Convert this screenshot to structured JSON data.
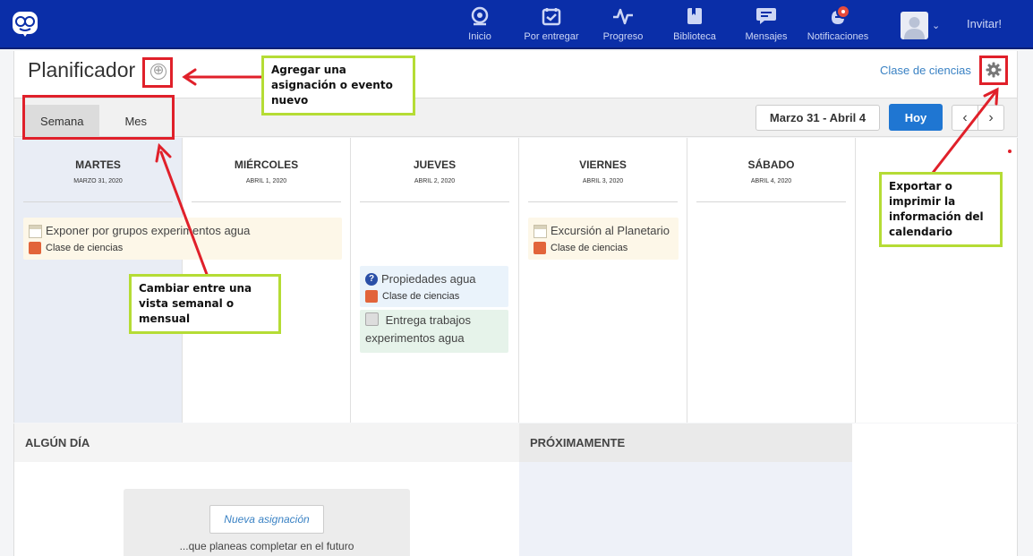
{
  "nav": {
    "items": [
      {
        "label": "Inicio",
        "icon": "home-icon"
      },
      {
        "label": "Por entregar",
        "icon": "assignments-icon"
      },
      {
        "label": "Progreso",
        "icon": "progress-icon"
      },
      {
        "label": "Biblioteca",
        "icon": "library-icon"
      },
      {
        "label": "Mensajes",
        "icon": "messages-icon"
      },
      {
        "label": "Notificaciones",
        "icon": "notifications-icon"
      }
    ],
    "invite": "Invitar!"
  },
  "planner": {
    "title": "Planificador",
    "add_symbol": "⊕",
    "class_link": "Clase de ciencias",
    "view_tabs": {
      "week": "Semana",
      "month": "Mes"
    },
    "date_range": "Marzo 31 - Abril 4",
    "today": "Hoy",
    "prev": "‹",
    "next": "›"
  },
  "days": [
    {
      "name": "MARTES",
      "date": "MARZO 31, 2020"
    },
    {
      "name": "MIÉRCOLES",
      "date": "ABRIL 1, 2020"
    },
    {
      "name": "JUEVES",
      "date": "ABRIL 2, 2020"
    },
    {
      "name": "VIERNES",
      "date": "ABRIL 3, 2020"
    },
    {
      "name": "SÁBADO",
      "date": "ABRIL 4, 2020"
    }
  ],
  "events": {
    "tuesday": {
      "title": "Exponer por grupos experimentos agua",
      "class": "Clase de ciencias"
    },
    "thursday_1": {
      "title": "Propiedades agua",
      "class": "Clase de ciencias"
    },
    "thursday_2": {
      "title": "Entrega trabajos experimentos agua"
    },
    "friday": {
      "title": "Excursión al Planetario",
      "class": "Clase de ciencias"
    }
  },
  "someday": {
    "title": "ALGÚN DÍA",
    "new_assignment": "Nueva asignación",
    "hint": "...que planeas completar en el futuro"
  },
  "upcoming": {
    "title": "PRÓXIMAMENTE"
  },
  "annotations": {
    "add": "Agregar una asignación o evento nuevo",
    "view": "Cambiar entre una vista semanal o mensual",
    "export": "Exportar o imprimir la información del calendario"
  },
  "colors": {
    "topbar": "#0a2ea8",
    "accent": "#1f76d2",
    "class_swatch": "#e2643a",
    "annotation_box": "#e0202a",
    "callout_border": "#b5dc35"
  }
}
